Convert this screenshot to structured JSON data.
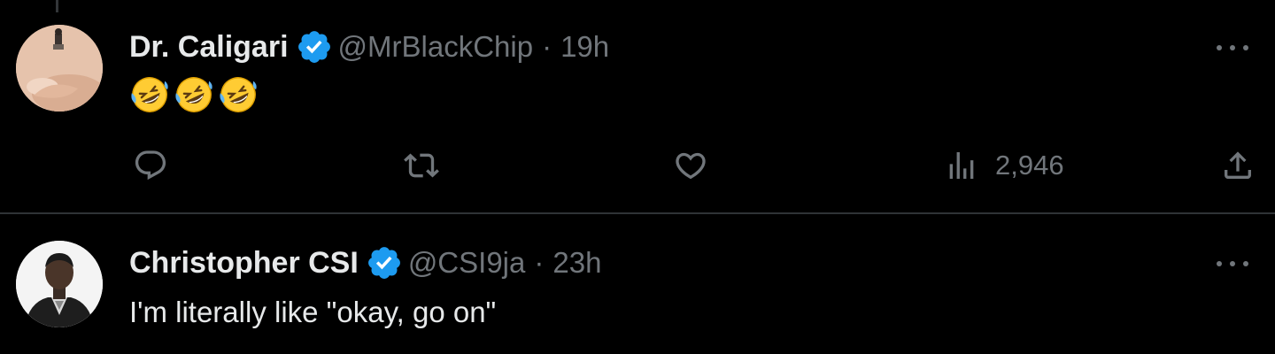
{
  "tweets": [
    {
      "author": {
        "display_name": "Dr. Caligari",
        "handle": "@MrBlackChip",
        "verified": true
      },
      "time": "19h",
      "body_emojis": [
        "rolling-on-floor-laughing-emoji",
        "rolling-on-floor-laughing-emoji",
        "rolling-on-floor-laughing-emoji"
      ],
      "actions": {
        "reply_icon": "reply-icon",
        "retweet_icon": "retweet-icon",
        "like_icon": "heart-icon",
        "views_icon": "views-chart-icon",
        "views_count": "2,946",
        "share_icon": "share-icon"
      }
    },
    {
      "author": {
        "display_name": "Christopher CSI",
        "handle": "@CSI9ja",
        "verified": true
      },
      "time": "23h",
      "body_text": "I'm literally like \"okay, go on\""
    }
  ],
  "separator": "·",
  "colors": {
    "background": "#000000",
    "primary_text": "#e7e9ea",
    "secondary_text": "#71767b",
    "verified_badge": "#1d9bf0",
    "divider": "#2f3336"
  }
}
